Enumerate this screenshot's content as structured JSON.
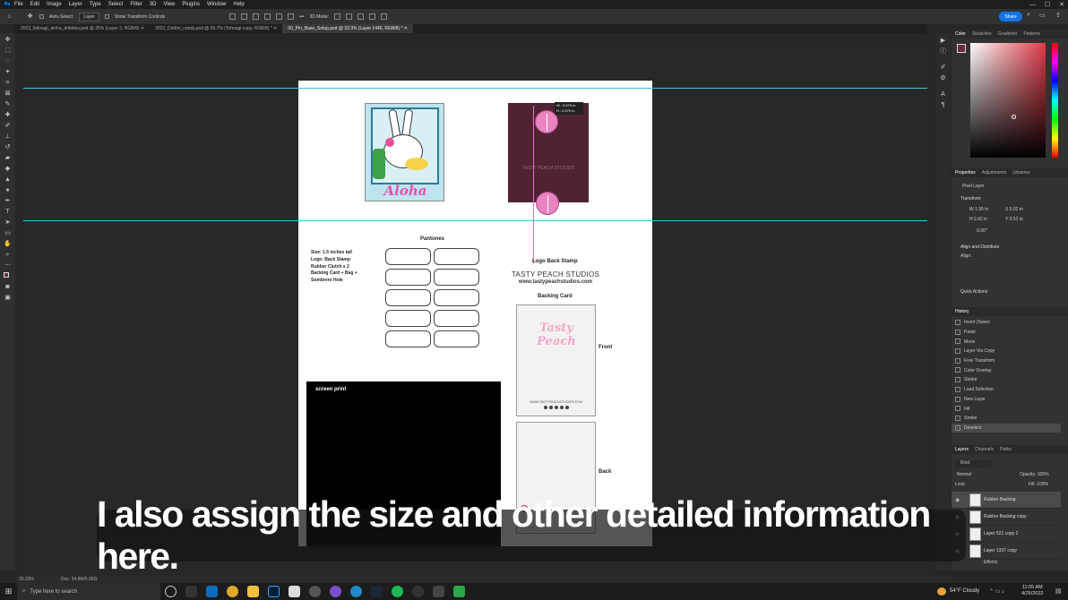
{
  "menu": [
    "File",
    "Edit",
    "Image",
    "Layer",
    "Type",
    "Select",
    "Filter",
    "3D",
    "View",
    "Plugins",
    "Window",
    "Help"
  ],
  "app_badge": "Ps",
  "options": {
    "auto_select": "Auto-Select:",
    "layer_select": "Layer",
    "transform_controls": "Show Transform Controls",
    "mode_3d": "3D Mode:",
    "share": "Share"
  },
  "tabs": [
    "2022_fellowgl_aloha_dribbles.psd @ 25% (Layer 3, RGB/8)",
    "2022_Cotton_candy.psd @ 66.7% (Tohoagi copy, RGB/8) *",
    "00_Pin_Base_Setup.psd @ 33.3% (Layer 1446, RGB/8) *"
  ],
  "measure": {
    "w": "W : 0.070 in",
    "h": "H : 0.470 in"
  },
  "doc": {
    "aloha": "Aloha",
    "back_brand": "TASTY PEACH STUDIOS",
    "pantones": "Pantones",
    "specs": [
      "Size: 1.5 inches tall",
      "Logo: Back Stamp",
      "Rubber Clutch x 2",
      "Backing Card + Bag +",
      "Sombrero Hole"
    ],
    "logo_back_stamp": "Logo Back Stamp",
    "brand": "TASTY PEACH STUDIOS",
    "url": "www.tastypeachstudios.com",
    "backing_card": "Backing Card",
    "front": "Front",
    "back": "Back",
    "screen_print": "screen print",
    "backing_logo": "Tasty Peach",
    "backing_url": "WWW.TASTYPEACHSTUDIOS.COM"
  },
  "panels": {
    "color_tabs": [
      "Color",
      "Swatches",
      "Gradients",
      "Patterns"
    ],
    "prop_tabs": [
      "Properties",
      "Adjustments",
      "Libraries"
    ],
    "pixel_layer": "Pixel Layer",
    "transform": "Transform",
    "w": "W  1.55 in",
    "h": "H  2.42 in",
    "x": "X  5.02 in",
    "y": "Y  0.52 in",
    "angle": "0.00°",
    "align": "Align and Distribute",
    "align_label": "Align:",
    "quick": "Quick Actions",
    "history_title": "History",
    "history": [
      "Invert (Save)",
      "Paste",
      "Move",
      "Layer Via Copy",
      "Free Transform",
      "Color Overlay",
      "Stroke",
      "Load Selection",
      "New Layer",
      "Fill",
      "Stroke",
      "Deselect"
    ],
    "layer_tabs": [
      "Layers",
      "Channels",
      "Paths"
    ],
    "kind": "Kind",
    "blend": "Normal",
    "opacity": "Opacity: 100%",
    "lock": "Lock:",
    "fill": "Fill: 100%",
    "layers": [
      "Rubber Backing",
      "Rubber Backing copy",
      "Layer 521 copy 2",
      "Layer 1337 copy"
    ],
    "effects": "Effects"
  },
  "status": {
    "zoom": "33.33%",
    "doc": "Doc: 34.8M/6.66G"
  },
  "taskbar": {
    "search": "Type here to search",
    "weather": "54°F  Cloudy",
    "time": "11:05 AM",
    "date": "4/25/2022"
  },
  "caption": "I also assign the size and other detailed information here.",
  "colors": {
    "accent": "#1473e6",
    "guide": "#3fc4d4",
    "pink": "#e884c0",
    "card_back": "#4f2332"
  }
}
